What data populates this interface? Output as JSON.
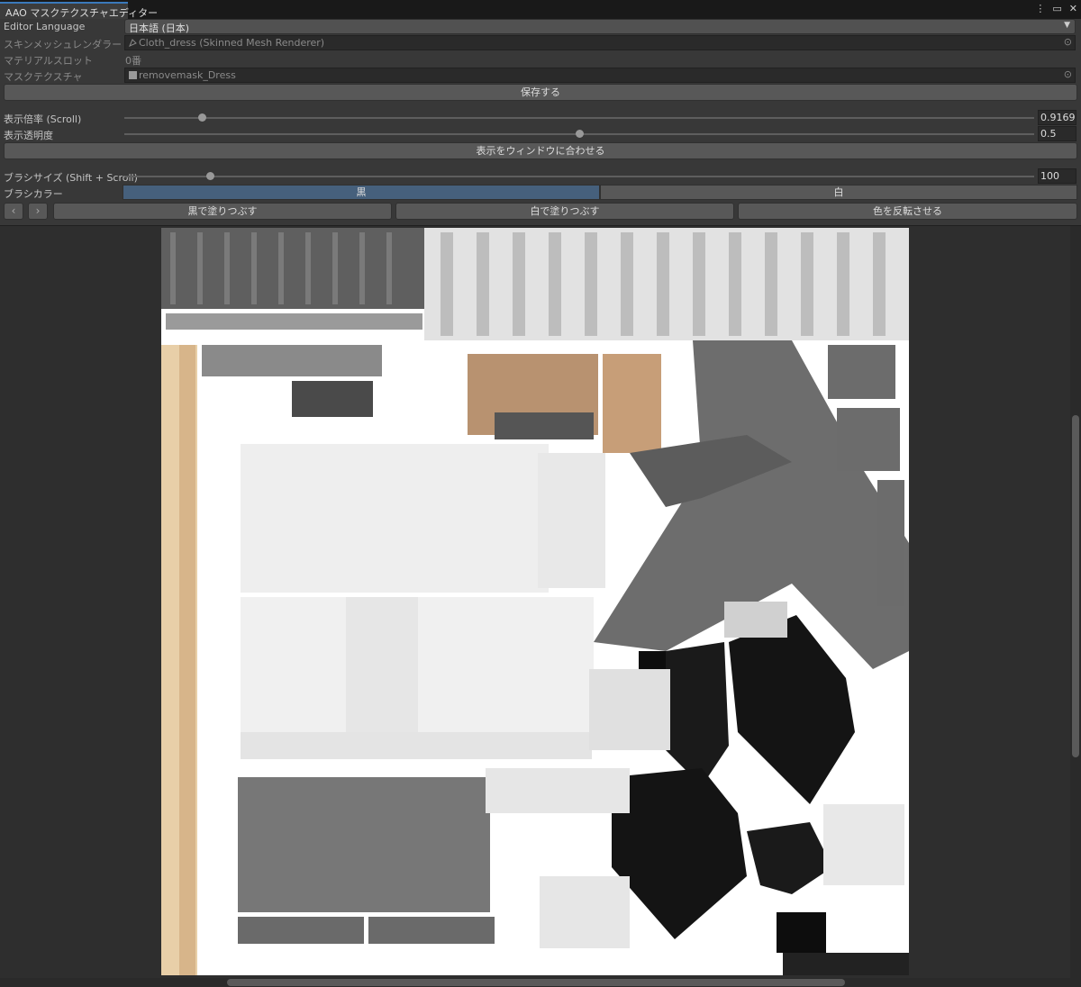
{
  "window": {
    "title": "AAO マスクテクスチャエディター",
    "menu_icon": "kebab-icon",
    "maximize_icon": "maximize-icon",
    "close_icon": "close-icon"
  },
  "editor_language": {
    "label": "Editor Language",
    "value": "日本語 (日本)"
  },
  "skinned_mesh_renderer": {
    "label": "スキンメッシュレンダラー",
    "value": "Cloth_dress (Skinned Mesh Renderer)"
  },
  "material_slot": {
    "label": "マテリアルスロット",
    "value": "0番"
  },
  "mask_texture": {
    "label": "マスクテクスチャ",
    "value": "removemask_Dress"
  },
  "save_button": "保存する",
  "zoom": {
    "label": "表示倍率 (Scroll)",
    "value": "0.91699",
    "slider_fraction": 0.085
  },
  "opacity": {
    "label": "表示透明度",
    "value": "0.5",
    "slider_fraction": 0.5
  },
  "fit_button": "表示をウィンドウに合わせる",
  "brush_size": {
    "label": "ブラシサイズ (Shift + Scroll)",
    "value": "100",
    "slider_fraction": 0.094
  },
  "brush_color": {
    "label": "ブラシカラー",
    "black": "黒",
    "white": "白",
    "selected": "黒"
  },
  "actions": {
    "undo_icon": "chevron-left-icon",
    "redo_icon": "chevron-right-icon",
    "fill_black": "黒で塗りつぶす",
    "fill_white": "白で塗りつぶす",
    "invert": "色を反転させる"
  },
  "colors": {
    "selected_option": "#46607c",
    "tab_accent": "#3a79bb"
  }
}
